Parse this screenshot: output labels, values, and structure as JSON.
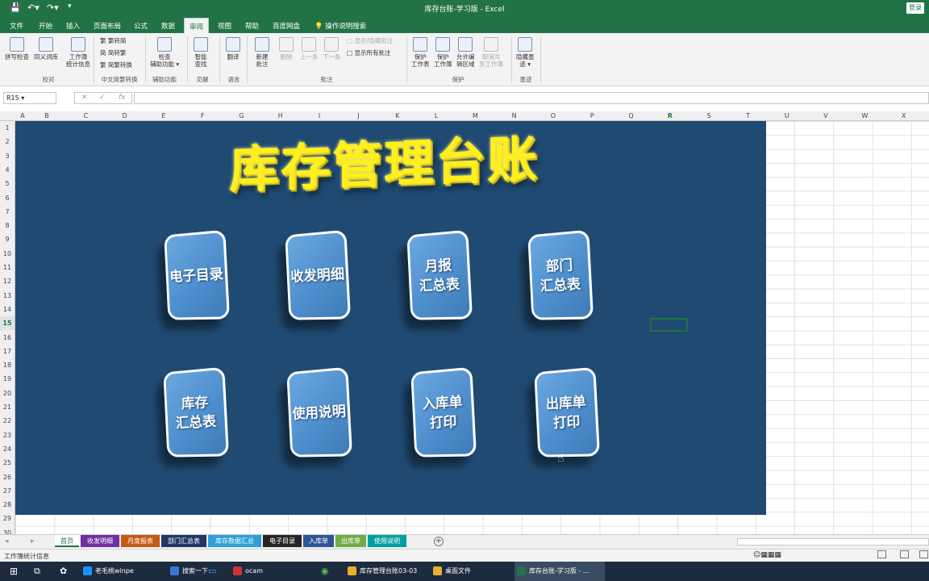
{
  "window": {
    "title": "库存台账-学习版  -  Excel",
    "login_label": "登录"
  },
  "qat": {
    "save_icon": "save-icon",
    "undo_icon": "undo-icon",
    "redo_icon": "redo-icon"
  },
  "menu": [
    "文件",
    "开始",
    "插入",
    "页面布局",
    "公式",
    "数据",
    "审阅",
    "视图",
    "帮助",
    "百度网盘",
    "操作说明搜索"
  ],
  "menu_active": "审阅",
  "ribbon": {
    "proofing": {
      "spell": "拼写检查",
      "thesaurus": "同义词库",
      "wordcount_1": "工作簿",
      "wordcount_2": "统计信息",
      "label": "校对"
    },
    "chinese": {
      "to_trad": "繁转简",
      "to_simp": "简转繁",
      "convert": "简繁转换",
      "label": "中文简繁转换"
    },
    "assist": {
      "check_1": "检查",
      "check_2": "辅助功能 ▾",
      "label": "辅助功能"
    },
    "insights": {
      "smart_1": "智能",
      "smart_2": "查找",
      "label": "见解"
    },
    "language": {
      "translate": "翻译",
      "label": "语言"
    },
    "comments": {
      "new_1": "新建",
      "new_2": "批注",
      "delete": "删除",
      "prev": "上一条",
      "next": "下一条",
      "show_hide": "显示/隐藏批注",
      "show_all": "显示所有批注",
      "label": "批注"
    },
    "protect": {
      "sheet_1": "保护",
      "sheet_2": "工作表",
      "wb_1": "保护",
      "wb_2": "工作簿",
      "allow_1": "允许编",
      "allow_2": "辑区域",
      "unshare_1": "取消共",
      "unshare_2": "享工作簿",
      "label": "保护"
    },
    "ink": {
      "hide_1": "隐藏墨",
      "hide_2": "迹 ▾",
      "label": "墨迹"
    }
  },
  "formula_bar": {
    "name_box": "R15 ▾",
    "cancel": "✕",
    "enter": "✓",
    "fx": "fx",
    "formula": ""
  },
  "columns": [
    "A",
    "B",
    "C",
    "D",
    "E",
    "F",
    "G",
    "H",
    "I",
    "J",
    "K",
    "L",
    "M",
    "N",
    "O",
    "P",
    "Q",
    "R",
    "S",
    "T",
    "U",
    "V",
    "W",
    "X"
  ],
  "selected_column": "R",
  "rows": [
    "1",
    "2",
    "3",
    "4",
    "5",
    "6",
    "7",
    "8",
    "9",
    "10",
    "11",
    "12",
    "13",
    "14",
    "15",
    "16",
    "17",
    "18",
    "19",
    "20",
    "21",
    "22",
    "23",
    "24",
    "25",
    "26",
    "27",
    "28",
    "29",
    "30"
  ],
  "selected_row": "15",
  "dashboard": {
    "title": "库存管理台账",
    "buttons": [
      "电子目录",
      "收发明细",
      "月报\n汇总表",
      "部门\n汇总表",
      "库存\n汇总表",
      "使用说明",
      "入库单\n打印",
      "出库单\n打印"
    ]
  },
  "sheets": [
    {
      "name": "首页",
      "color": "#ffffff"
    },
    {
      "name": "收发明细",
      "color": "#7030a0"
    },
    {
      "name": "月度报表",
      "color": "#c55a11"
    },
    {
      "name": "部门汇总表",
      "color": "#1f3864"
    },
    {
      "name": "库存数据汇总",
      "color": "#2e9fd8"
    },
    {
      "name": "电子目录",
      "color": "#262626"
    },
    {
      "name": "入库单",
      "color": "#2f5597"
    },
    {
      "name": "出库单",
      "color": "#70ad47"
    },
    {
      "name": "使用说明",
      "color": "#00a0a0"
    }
  ],
  "status": {
    "text": "工作簿统计信息"
  },
  "taskbar": [
    {
      "label": "老毛桃winpe",
      "color": "#1e90ff"
    },
    {
      "label": "搜索一下",
      "color": "#3a78d8"
    },
    {
      "label": "ocam",
      "color": "#cc3333"
    },
    {
      "label": "库存管理台账03-03",
      "color": "#e8b02c"
    },
    {
      "label": "桌面文件",
      "color": "#e8b02c"
    },
    {
      "label": "库存台账-学习版 - ...",
      "color": "#217346"
    }
  ]
}
